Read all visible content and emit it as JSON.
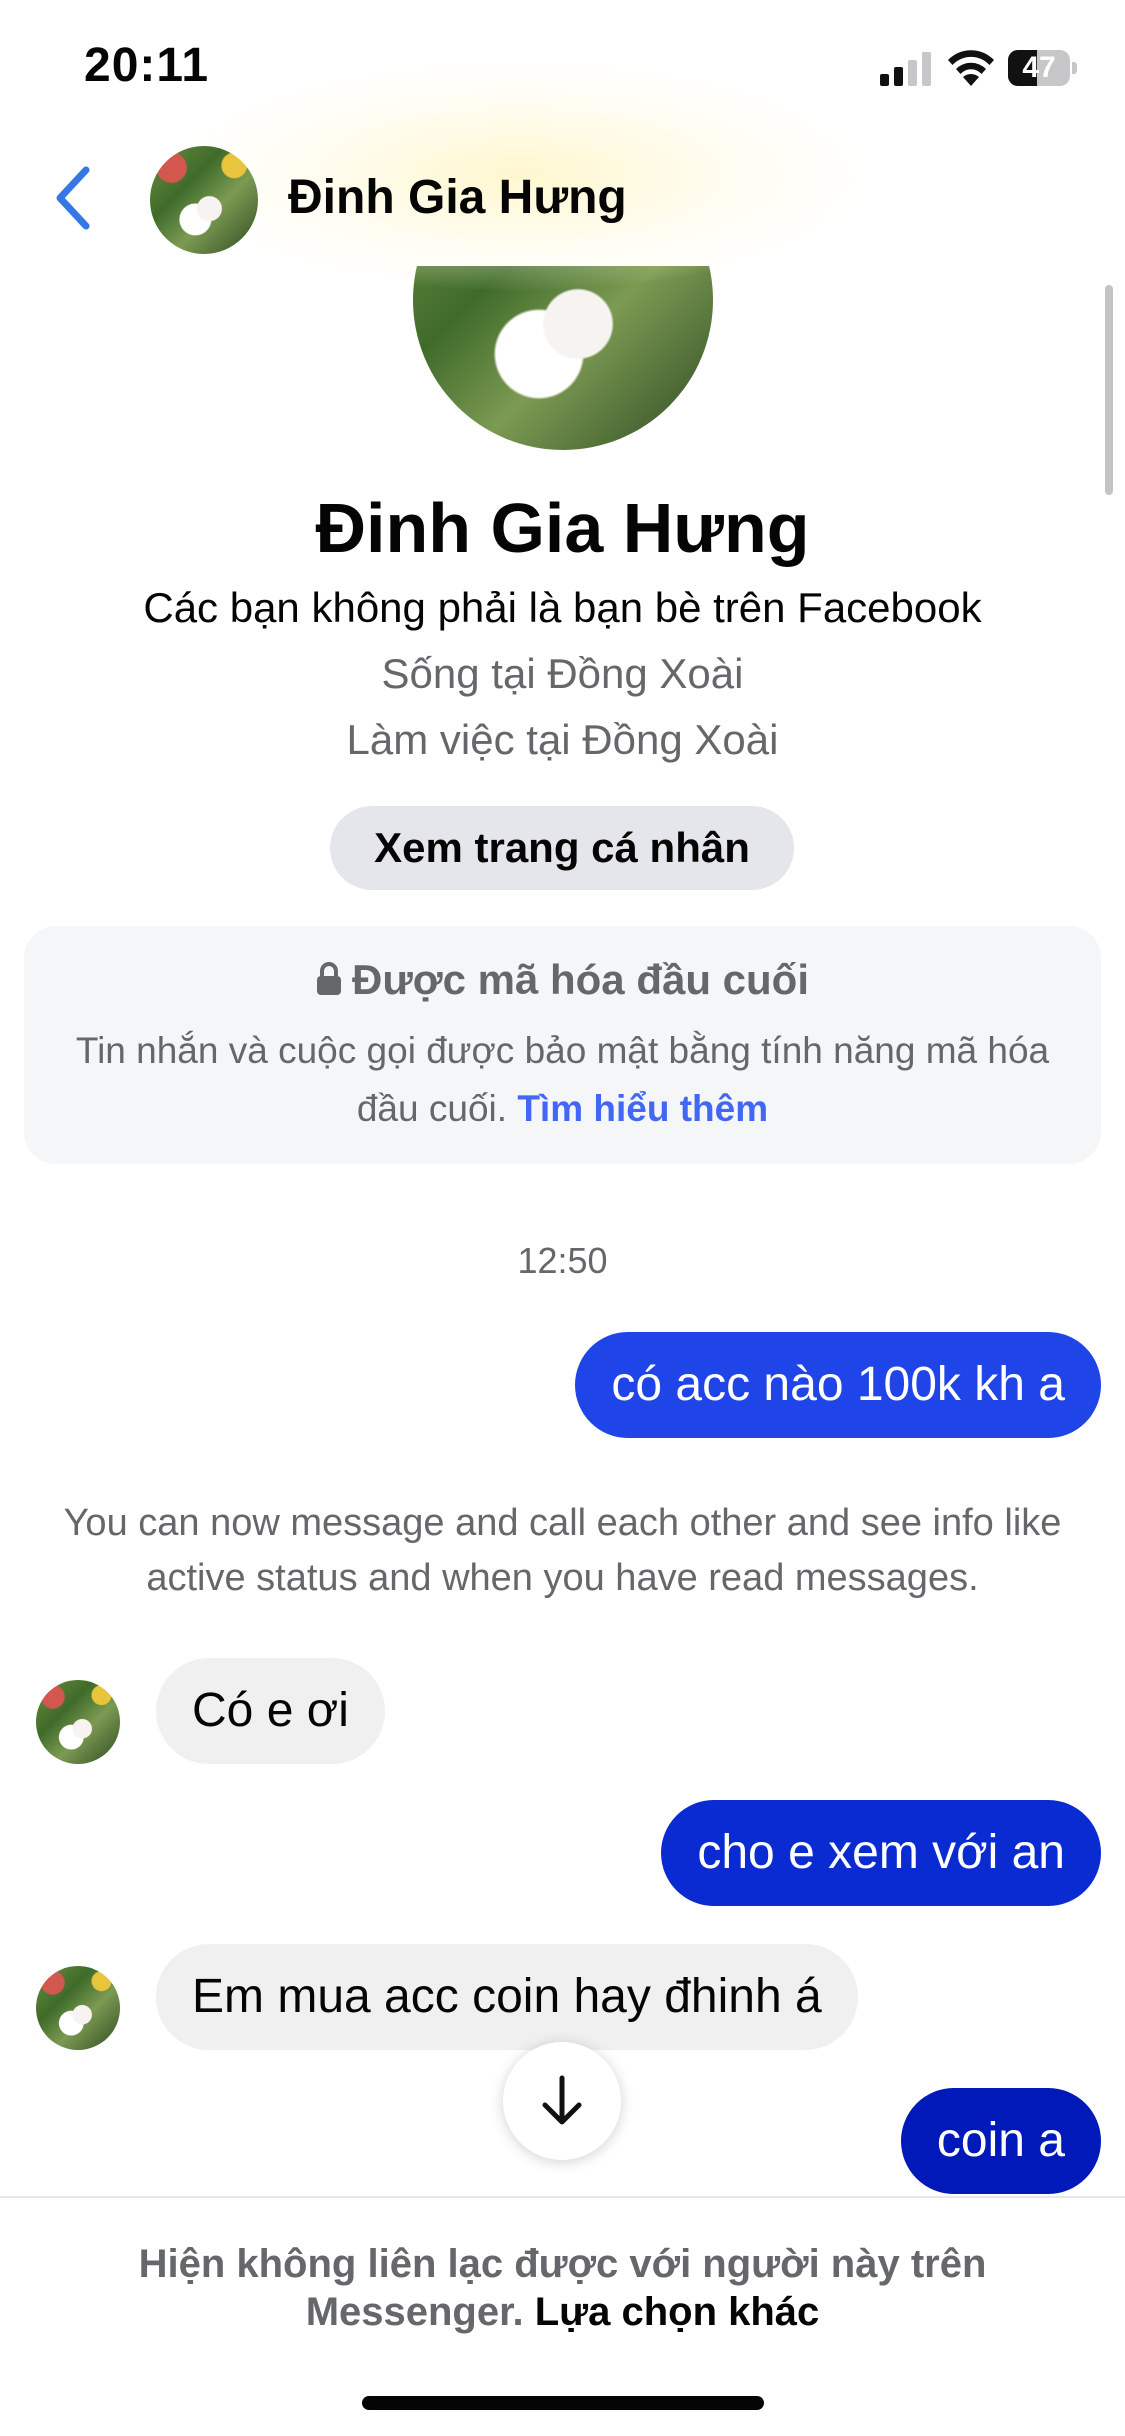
{
  "status_bar": {
    "time": "20:11",
    "battery_percent": "47",
    "signal_bars": 2
  },
  "header": {
    "contact_name": "Đinh Gia Hưng",
    "back_icon": "chevron-left-icon"
  },
  "profile": {
    "name": "Đinh Gia Hưng",
    "friend_status": "Các bạn không phải là bạn bè trên Facebook",
    "lives_in": "Sống tại Đồng Xoài",
    "works_at": "Làm việc tại Đồng Xoài",
    "view_profile_label": "Xem trang cá nhân"
  },
  "encryption": {
    "title": "Được mã hóa đầu cuối",
    "body": "Tin nhắn và cuộc gọi được bảo mật bằng tính năng mã hóa đầu cuối.",
    "link": "Tìm hiểu thêm"
  },
  "conversation": {
    "timestamp": "12:50",
    "messages": [
      {
        "from": "me",
        "text": "có acc nào 100k kh a"
      },
      {
        "from": "system",
        "text": "You can now message and call each other and see info like active status and when you have read messages."
      },
      {
        "from": "them",
        "text": "Có e ơi"
      },
      {
        "from": "me",
        "text": "cho e xem với an"
      },
      {
        "from": "them",
        "text": "Em mua acc coin hay đhinh á"
      },
      {
        "from": "me",
        "text": "coin a"
      }
    ]
  },
  "footer": {
    "notice": "Hiện không liên lạc được với người này trên Messenger.",
    "link": "Lựa chọn khác"
  },
  "colors": {
    "accent": "#1f45e8",
    "link": "#4267f5",
    "secondary_text": "#65676b",
    "incoming_bubble": "#f0f0f0"
  }
}
